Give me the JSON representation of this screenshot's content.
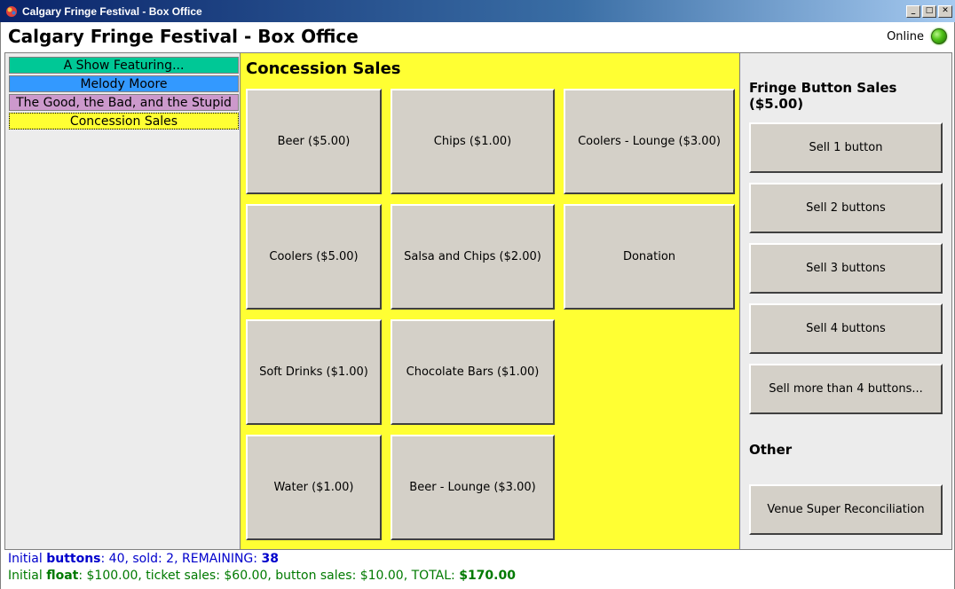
{
  "window": {
    "title": "Calgary Fringe Festival - Box Office",
    "controls": {
      "minimize": "_",
      "maximize": "□",
      "close": "✕"
    }
  },
  "header": {
    "app_title": "Calgary Fringe Festival - Box Office",
    "status_label": "Online",
    "status_color": "#52c41a"
  },
  "shows": [
    {
      "label": "A Show Featuring...",
      "color": "#00c896"
    },
    {
      "label": "Melody Moore",
      "color": "#3399ff"
    },
    {
      "label": "The Good, the Bad, and the Stupid",
      "color": "#cc99cc"
    },
    {
      "label": "Concession Sales",
      "color": "#ffff33"
    }
  ],
  "concession": {
    "title": "Concession Sales",
    "items": [
      "Beer ($5.00)",
      "Chips ($1.00)",
      "Coolers - Lounge ($3.00)",
      "Coolers ($5.00)",
      "Salsa and Chips ($2.00)",
      "Donation",
      "Soft Drinks ($1.00)",
      "Chocolate Bars ($1.00)",
      "Water ($1.00)",
      "Beer - Lounge ($3.00)"
    ]
  },
  "fringe_buttons": {
    "title": "Fringe Button Sales ($5.00)",
    "actions": [
      "Sell 1 button",
      "Sell 2 buttons",
      "Sell 3 buttons",
      "Sell 4 buttons",
      "Sell more than 4 buttons..."
    ]
  },
  "other": {
    "title": "Other",
    "actions": [
      "Venue Super Reconciliation"
    ]
  },
  "status": {
    "line1": {
      "initial": "Initial ",
      "buttons_word": "buttons",
      "mid": ": 40, sold: 2, REMAINING: ",
      "remaining": "38"
    },
    "line2": {
      "initial": "Initial ",
      "float_word": "float",
      "mid": ": $100.00, ticket sales: $60.00, button sales: $10.00, TOTAL: ",
      "total": "$170.00"
    }
  }
}
